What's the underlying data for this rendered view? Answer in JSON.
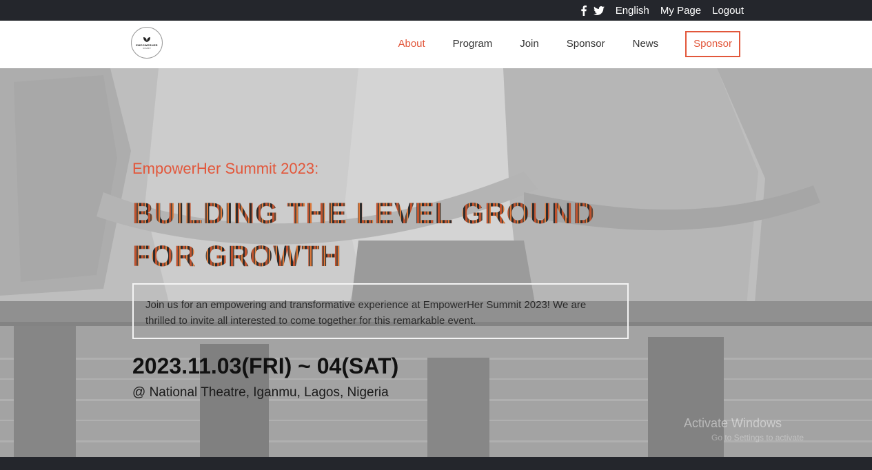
{
  "topbar": {
    "social": [
      "facebook-icon",
      "twitter-icon"
    ],
    "language": "English",
    "my_page": "My Page",
    "logout": "Logout"
  },
  "header": {
    "logo": {
      "name": "EMPOWERHER",
      "sub": "SUMMIT"
    },
    "nav": [
      "About",
      "Program",
      "Join",
      "Sponsor",
      "News"
    ],
    "active": "About",
    "cta": "Sponsor"
  },
  "hero": {
    "eyebrow": "EmpowerHer Summit 2023:",
    "headline_line1": "BUILDING THE LEVEL GROUND",
    "headline_line2": "FOR GROWTH",
    "intro": "Join us for an empowering and transformative experience at EmpowerHer Summit 2023! We are thrilled to invite all interested to come together for this remarkable event.",
    "date": "2023.11.03(FRI) ~ 04(SAT)",
    "venue": "@ National Theatre, Iganmu, Lagos, Nigeria"
  },
  "watermark": {
    "title": "Activate Windows",
    "sub": "Go to Settings to activate"
  },
  "colors": {
    "accent": "#e2573b",
    "dark": "#24262c"
  }
}
